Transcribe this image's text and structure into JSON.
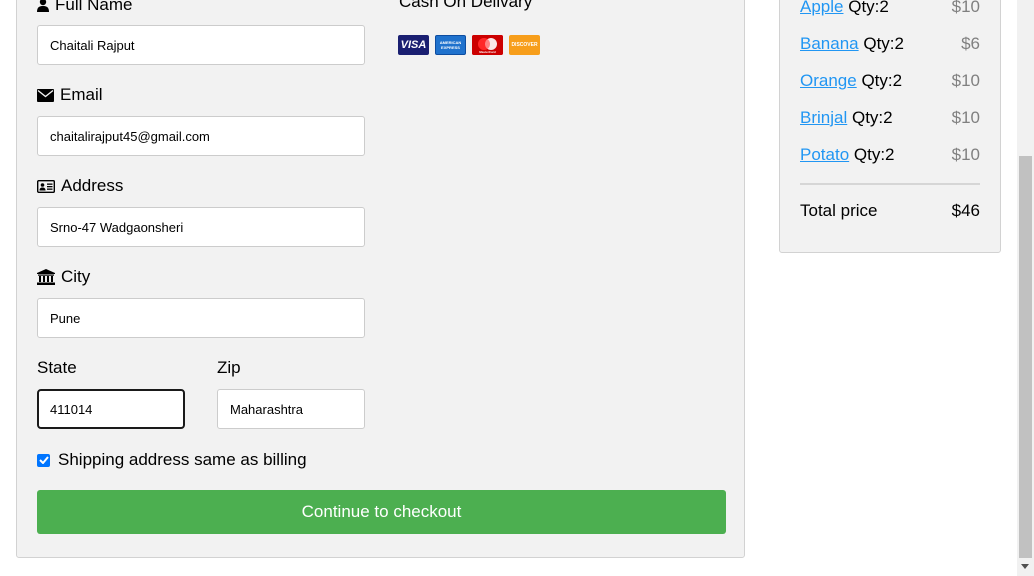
{
  "billing": {
    "fullname_label": "Full Name",
    "fullname_value": "Chaitali Rajput",
    "email_label": "Email",
    "email_value": "chaitalirajput45@gmail.com",
    "address_label": "Address",
    "address_value": "Srno-47 Wadgaonsheri",
    "city_label": "City",
    "city_value": "Pune",
    "state_label": "State",
    "state_value": "411014",
    "zip_label": "Zip",
    "zip_value": "Maharashtra"
  },
  "payment": {
    "label": "Cash On Delivary",
    "cards": [
      {
        "name": "VISA",
        "color": "#1a1f71"
      },
      {
        "name": "AMERICAN EXPRESS",
        "color": "#1f72cd"
      },
      {
        "name": "MasterCard",
        "color": "#eb001b"
      },
      {
        "name": "DISCOVER",
        "color": "#f79e1b"
      }
    ]
  },
  "shipping": {
    "checkbox_label": "Shipping address same as billing",
    "checked": true
  },
  "checkout_button": "Continue to checkout",
  "cart": {
    "items": [
      {
        "name": "Apple",
        "qty": "Qty:2",
        "price": "$10"
      },
      {
        "name": "Banana",
        "qty": "Qty:2",
        "price": "$6"
      },
      {
        "name": "Orange",
        "qty": "Qty:2",
        "price": "$10"
      },
      {
        "name": "Brinjal",
        "qty": "Qty:2",
        "price": "$10"
      },
      {
        "name": "Potato",
        "qty": "Qty:2",
        "price": "$10"
      }
    ],
    "total_label": "Total price",
    "total_value": "$46"
  },
  "colors": {
    "accent_button": "#4caf50",
    "link": "#2196f3",
    "card_bg": "#f2f2f2"
  }
}
